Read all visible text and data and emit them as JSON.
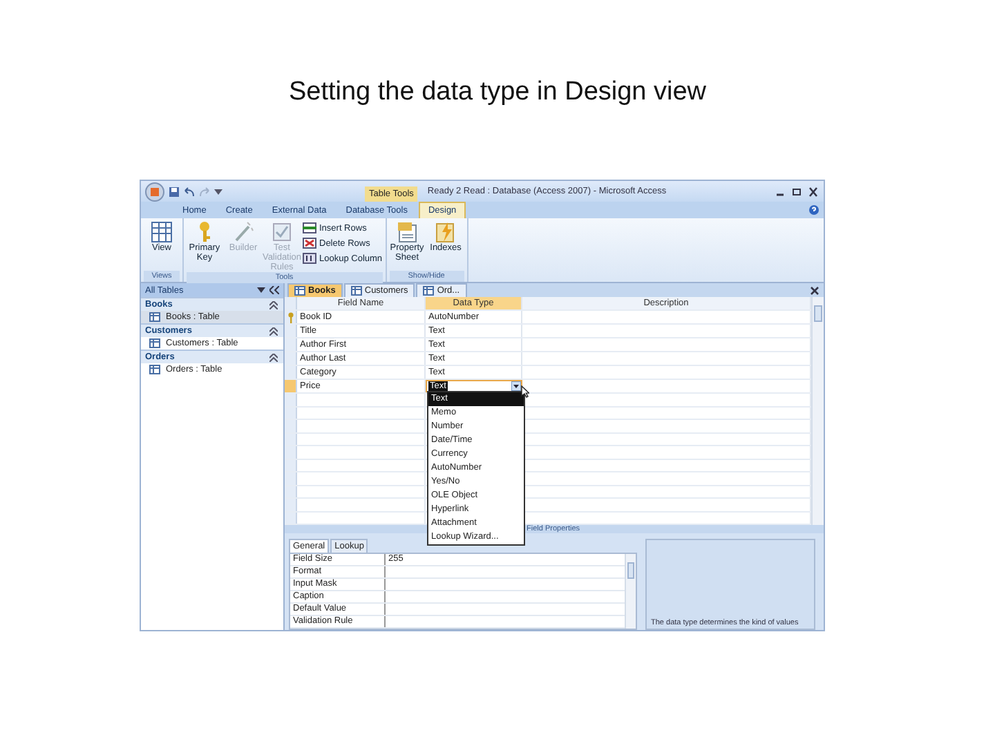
{
  "slide_title": "Setting the data type in Design view",
  "window": {
    "title": "Ready 2 Read : Database (Access 2007) - Microsoft Access",
    "context_label": "Table Tools"
  },
  "ribbon_tabs": [
    {
      "label": "Home",
      "selected": false
    },
    {
      "label": "Create",
      "selected": false
    },
    {
      "label": "External Data",
      "selected": false
    },
    {
      "label": "Database Tools",
      "selected": false
    },
    {
      "label": "Design",
      "selected": true
    }
  ],
  "ribbon_groups": [
    {
      "label": "Views",
      "buttons": [
        {
          "kind": "large",
          "label": "View",
          "disabled": false
        }
      ]
    },
    {
      "label": "Tools",
      "buttons": [
        {
          "kind": "large",
          "label": "Primary Key",
          "disabled": false
        },
        {
          "kind": "large",
          "label": "Builder",
          "disabled": true
        },
        {
          "kind": "large",
          "label": "Test Validation Rules",
          "disabled": true
        },
        {
          "kind": "small",
          "label": "Insert Rows",
          "disabled": false
        },
        {
          "kind": "small",
          "label": "Delete Rows",
          "disabled": false
        },
        {
          "kind": "small",
          "label": "Lookup Column",
          "disabled": false
        }
      ]
    },
    {
      "label": "Show/Hide",
      "buttons": [
        {
          "kind": "large",
          "label": "Property Sheet",
          "disabled": false
        },
        {
          "kind": "large",
          "label": "Indexes",
          "disabled": false
        }
      ]
    }
  ],
  "nav": {
    "title": "All Tables",
    "groups": [
      {
        "label": "Books",
        "items": [
          {
            "label": "Books : Table",
            "selected": true
          }
        ]
      },
      {
        "label": "Customers",
        "items": [
          {
            "label": "Customers : Table",
            "selected": false
          }
        ]
      },
      {
        "label": "Orders",
        "items": [
          {
            "label": "Orders : Table",
            "selected": false
          }
        ]
      }
    ]
  },
  "doc_tabs": [
    {
      "label": "Books",
      "selected": true
    },
    {
      "label": "Customers",
      "selected": false
    },
    {
      "label": "Ord...",
      "selected": false
    }
  ],
  "columns": [
    "Field Name",
    "Data Type",
    "Description"
  ],
  "fields": [
    {
      "name": "Book ID",
      "data_type": "AutoNumber",
      "primary_key": true,
      "selected": false
    },
    {
      "name": "Title",
      "data_type": "Text",
      "primary_key": false,
      "selected": false
    },
    {
      "name": "Author First",
      "data_type": "Text",
      "primary_key": false,
      "selected": false
    },
    {
      "name": "Author Last",
      "data_type": "Text",
      "primary_key": false,
      "selected": false
    },
    {
      "name": "Category",
      "data_type": "Text",
      "primary_key": false,
      "selected": false
    },
    {
      "name": "Price",
      "data_type": "Text",
      "primary_key": false,
      "selected": true
    }
  ],
  "dropdown_options": [
    {
      "label": "Text",
      "selected": true
    },
    {
      "label": "Memo",
      "selected": false
    },
    {
      "label": "Number",
      "selected": false
    },
    {
      "label": "Date/Time",
      "selected": false
    },
    {
      "label": "Currency",
      "selected": false
    },
    {
      "label": "AutoNumber",
      "selected": false
    },
    {
      "label": "Yes/No",
      "selected": false
    },
    {
      "label": "OLE Object",
      "selected": false
    },
    {
      "label": "Hyperlink",
      "selected": false
    },
    {
      "label": "Attachment",
      "selected": false
    },
    {
      "label": "Lookup Wizard...",
      "selected": false
    }
  ],
  "field_properties_label": "Field Properties",
  "property_tabs": [
    {
      "label": "General",
      "selected": true
    },
    {
      "label": "Lookup",
      "selected": false
    }
  ],
  "properties": [
    {
      "name": "Field Size",
      "value": "255"
    },
    {
      "name": "Format"
    },
    {
      "name": "Input Mask"
    },
    {
      "name": "Caption"
    },
    {
      "name": "Default Value"
    },
    {
      "name": "Validation Rule"
    }
  ],
  "help_text": "The data type determines the kind of values"
}
